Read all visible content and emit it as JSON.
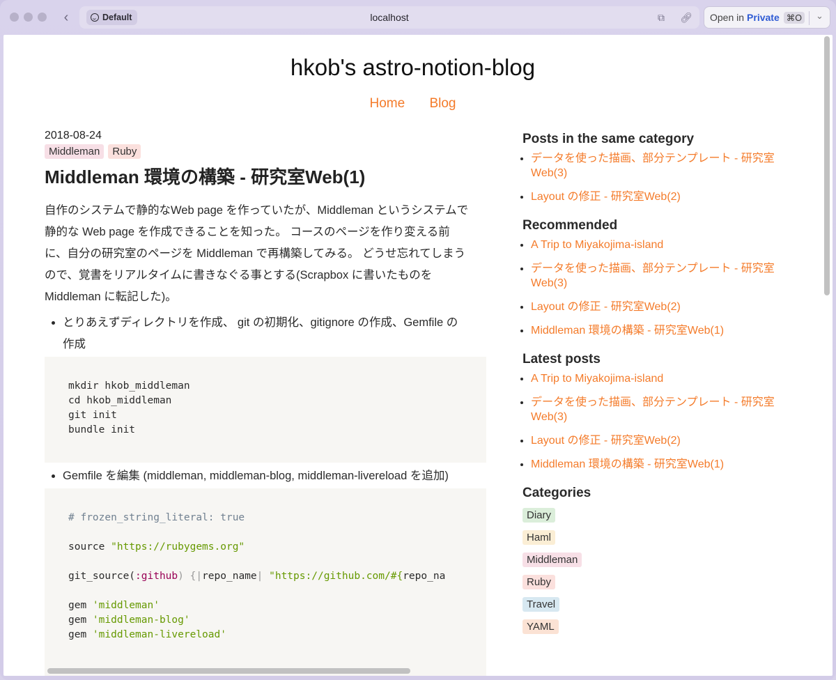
{
  "browser": {
    "profile_label": "Default",
    "url": "localhost",
    "open_in_label": "Open in",
    "private_label": "Private",
    "shortcut": "⌘O"
  },
  "site": {
    "title": "hkob's astro-notion-blog",
    "nav": [
      "Home",
      "Blog"
    ]
  },
  "post": {
    "date": "2018-08-24",
    "tags": [
      "Middleman",
      "Ruby"
    ],
    "title": "Middleman 環境の構築 - 研究室Web(1)",
    "intro_lines": [
      "自作のシステムで静的なWeb page を作っていたが、Middleman というシステムで",
      "静的な Web page を作成できることを知った。 コースのページを作り変える前",
      "に、自分の研究室のページを Middleman で再構築してみる。 どうせ忘れてしまう",
      "ので、覚書をリアルタイムに書きなぐる事とする(Scrapbox に書いたものを",
      "Middleman に転記した)。"
    ],
    "bullet1_lines": [
      "とりあえずディレクトリを作成、 git の初期化、gitignore の作成、Gemfile の",
      "作成"
    ],
    "code1": [
      "mkdir hkob_middleman",
      "cd hkob_middleman",
      "git init",
      "bundle init"
    ],
    "bullet2": "Gemfile を編集 (middleman, middleman-blog, middleman-livereload を追加)",
    "code2": {
      "comment": "# frozen_string_literal: true",
      "source_kw": "source ",
      "source_url": "\"https://rubygems.org\"",
      "gitsource_kw": "git_source(",
      "gitsource_sym": ":github",
      "gitsource_rest": ") {",
      "gitsource_pipe_open": "|",
      "gitsource_arg": "repo_name",
      "gitsource_pipe_close": "|",
      "gitsource_str": " \"https://github.com/#{",
      "gitsource_tail": "repo_na",
      "gem_kw": "gem ",
      "gems": [
        "'middleman'",
        "'middleman-blog'",
        "'middleman-livereload'"
      ]
    }
  },
  "sidebar": {
    "same_category_title": "Posts in the same category",
    "same_category": [
      "データを使った描画、部分テンプレート - 研究室Web(3)",
      "Layout の修正 - 研究室Web(2)"
    ],
    "recommended_title": "Recommended",
    "recommended": [
      "A Trip to Miyakojima-island",
      "データを使った描画、部分テンプレート - 研究室Web(3)",
      "Layout の修正 - 研究室Web(2)",
      "Middleman 環境の構築 - 研究室Web(1)"
    ],
    "latest_title": "Latest posts",
    "latest": [
      "A Trip to Miyakojima-island",
      "データを使った描画、部分テンプレート - 研究室Web(3)",
      "Layout の修正 - 研究室Web(2)",
      "Middleman 環境の構築 - 研究室Web(1)"
    ],
    "categories_title": "Categories",
    "categories": [
      "Diary",
      "Haml",
      "Middleman",
      "Ruby",
      "Travel",
      "YAML"
    ]
  },
  "colors": {
    "link": "#f47b2a",
    "code_bg": "#f7f6f3"
  }
}
